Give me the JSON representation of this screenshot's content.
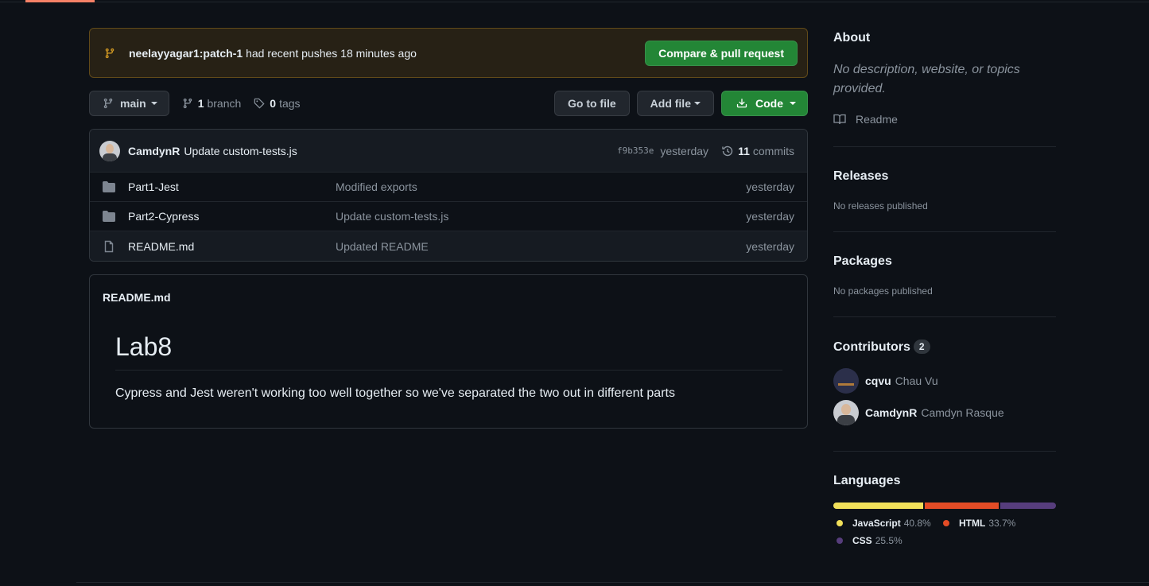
{
  "banner": {
    "branch": "neelayyagar1:patch-1",
    "text": "had recent pushes 18 minutes ago",
    "button": "Compare & pull request"
  },
  "toolbar": {
    "branch_name": "main",
    "branch_count": "1",
    "branch_label": "branch",
    "tag_count": "0",
    "tag_label": "tags",
    "goto_file": "Go to file",
    "add_file": "Add file",
    "code": "Code"
  },
  "commit": {
    "author": "CamdynR",
    "message": "Update custom-tests.js",
    "sha": "f9b353e",
    "when": "yesterday",
    "count": "11",
    "count_label": "commits"
  },
  "files": [
    {
      "name": "Part1-Jest",
      "type": "dir",
      "message": "Modified exports",
      "date": "yesterday"
    },
    {
      "name": "Part2-Cypress",
      "type": "dir",
      "message": "Update custom-tests.js",
      "date": "yesterday"
    },
    {
      "name": "README.md",
      "type": "file",
      "message": "Updated README",
      "date": "yesterday"
    }
  ],
  "readme": {
    "file_title": "README.md",
    "heading": "Lab8",
    "body": "Cypress and Jest weren't working too well together so we've separated the two out in different parts"
  },
  "sidebar": {
    "about_title": "About",
    "about_desc": "No description, website, or topics provided.",
    "readme_link": "Readme",
    "releases_title": "Releases",
    "releases_text": "No releases published",
    "packages_title": "Packages",
    "packages_text": "No packages published",
    "contributors_title": "Contributors",
    "contributors_count": "2",
    "contributors": [
      {
        "login": "cqvu",
        "name": "Chau Vu"
      },
      {
        "login": "CamdynR",
        "name": "Camdyn Rasque"
      }
    ],
    "languages_title": "Languages",
    "languages": [
      {
        "name": "JavaScript",
        "percent": "40.8%",
        "value": 40.8,
        "color": "#f1e05a"
      },
      {
        "name": "HTML",
        "percent": "33.7%",
        "value": 33.7,
        "color": "#e34c26"
      },
      {
        "name": "CSS",
        "percent": "25.5%",
        "value": 25.5,
        "color": "#563d7c"
      }
    ]
  },
  "colors": {
    "accent_green": "#238636",
    "background": "#0d1117"
  }
}
